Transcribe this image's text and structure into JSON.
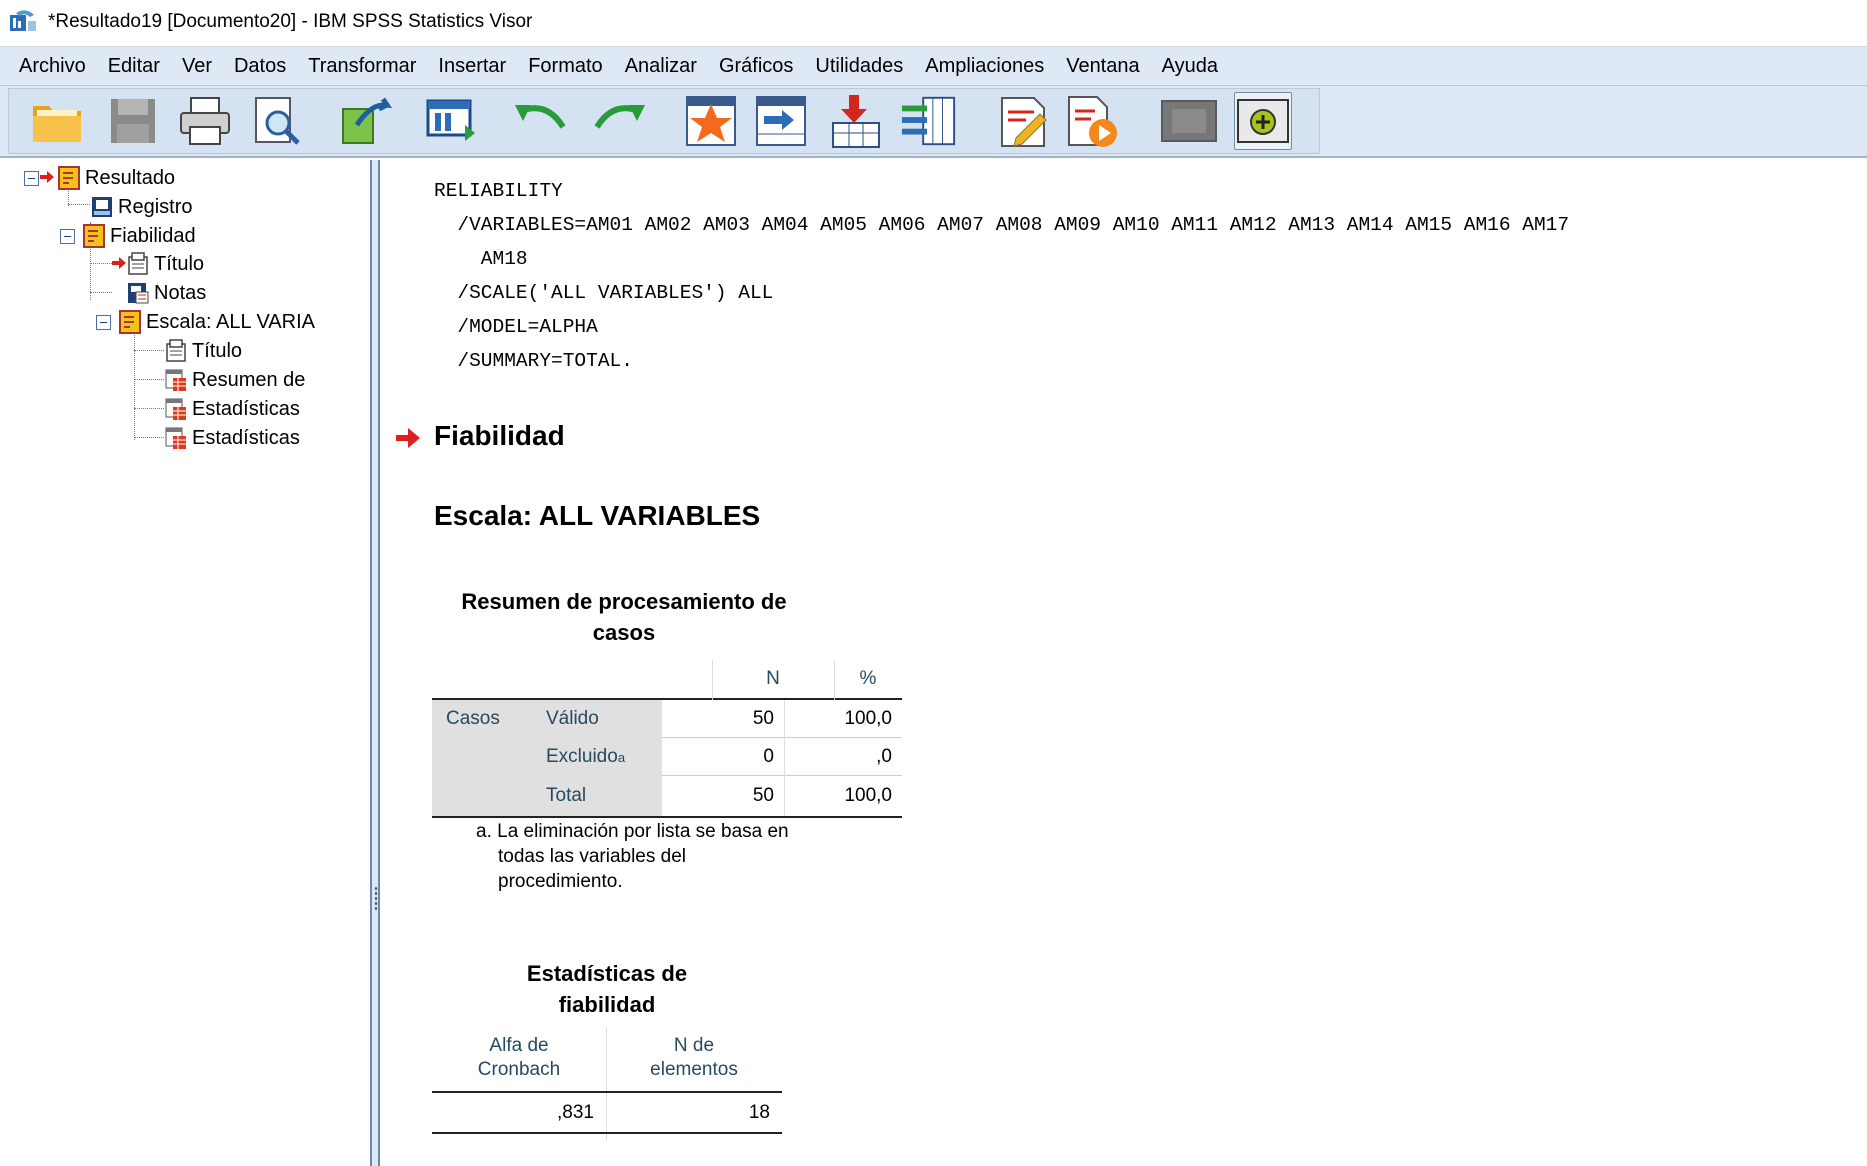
{
  "window": {
    "title": "*Resultado19 [Documento20] - IBM SPSS Statistics Visor",
    "app_icon": "spss-app-icon"
  },
  "menu": {
    "items": [
      "Archivo",
      "Editar",
      "Ver",
      "Datos",
      "Transformar",
      "Insertar",
      "Formato",
      "Analizar",
      "Gráficos",
      "Utilidades",
      "Ampliaciones",
      "Ventana",
      "Ayuda"
    ]
  },
  "toolbar": {
    "buttons": [
      "open-icon",
      "save-icon",
      "print-icon",
      "print-preview-icon",
      "export-icon",
      "goto-data-icon",
      "undo-icon",
      "redo-icon",
      "goto-case-icon",
      "goto-variable-icon",
      "insert-cases-icon",
      "insert-variable-icon",
      "designate-window-icon",
      "run-script-icon",
      "hide-icon",
      "add-icon"
    ]
  },
  "outline": {
    "root": "Resultado",
    "log": "Registro",
    "reliability": "Fiabilidad",
    "title": "Título",
    "notes": "Notas",
    "scale": "Escala: ALL VARIA",
    "scale_title": "Título",
    "summary": "Resumen de",
    "stats1": "Estadísticas",
    "stats2": "Estadísticas"
  },
  "viewer": {
    "syntax_lines": [
      "RELIABILITY",
      "  /VARIABLES=AM01 AM02 AM03 AM04 AM05 AM06 AM07 AM08 AM09 AM10 AM11 AM12 AM13 AM14 AM15 AM16 AM17",
      "    AM18",
      "  /SCALE('ALL VARIABLES') ALL",
      "  /MODEL=ALPHA",
      "  /SUMMARY=TOTAL."
    ],
    "heading": "Fiabilidad",
    "subheading": "Escala: ALL VARIABLES",
    "case_summary": {
      "title_line1": "Resumen de procesamiento de",
      "title_line2": "casos",
      "col_n": "N",
      "col_pct": "%",
      "group": "Casos",
      "rows": [
        {
          "label": "Válido",
          "sup": "",
          "n": "50",
          "pct": "100,0"
        },
        {
          "label": "Excluido",
          "sup": "a",
          "n": "0",
          "pct": ",0"
        },
        {
          "label": "Total",
          "sup": "",
          "n": "50",
          "pct": "100,0"
        }
      ],
      "footnote_line1": "a. La eliminación por lista se basa en",
      "footnote_line2": "todas las variables del",
      "footnote_line3": "procedimiento."
    },
    "reliability_stats": {
      "title_line1": "Estadísticas de",
      "title_line2": "fiabilidad",
      "col1_line1": "Alfa de",
      "col1_line2": "Cronbach",
      "col2_line1": "N de",
      "col2_line2": "elementos",
      "alpha": ",831",
      "n_items": "18"
    }
  }
}
